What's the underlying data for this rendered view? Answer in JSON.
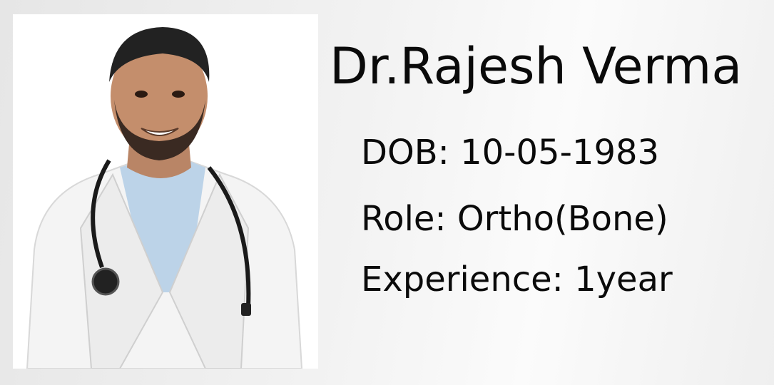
{
  "card": {
    "name": "Dr.Rajesh Verma",
    "dob": "DOB: 10-05-1983",
    "role": "Role: Ortho(Bone)",
    "experience": "Experience: 1year"
  },
  "photo": {
    "icon": "doctor-portrait-image",
    "coat_color": "#ffffff",
    "shirt_color": "#bcd3e8",
    "stethoscope_color": "#1a1a1a"
  }
}
